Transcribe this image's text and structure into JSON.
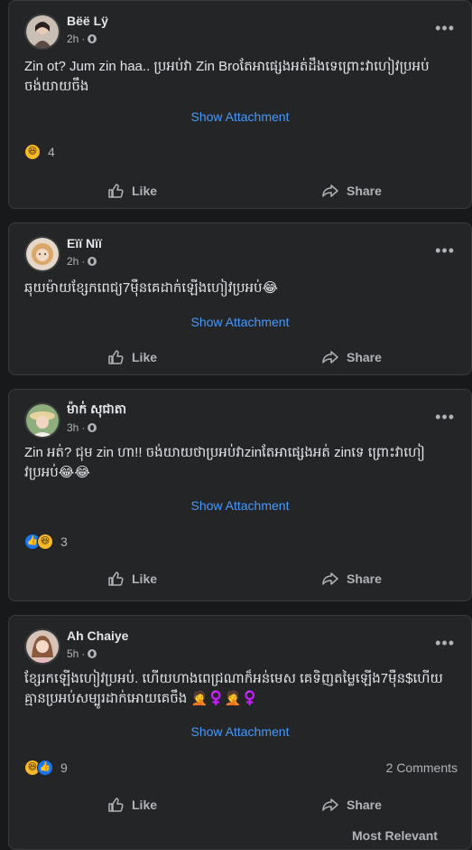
{
  "posts": [
    {
      "name": "Bëë Lÿ",
      "time": "2h",
      "text": "Zin ot? Jum zin haa.. ប្រអប់វា Zin Broតែអាផ្សេងអត់ដឹងទេព្រោះវាហៀវប្រអប់ ចង់យាយចឹង",
      "attachment": "Show Attachment",
      "reaction_count": "4",
      "reactions": [
        "haha"
      ],
      "like": "Like",
      "share": "Share"
    },
    {
      "name": "Eïï Nïï",
      "time": "2h",
      "text": "ឆុយម៉ាយខ្សែកពេជ្យ7ម៉ឺនគេដាក់ឡើងហៀវប្រអប់😂",
      "attachment": "Show Attachment",
      "like": "Like",
      "share": "Share"
    },
    {
      "name": "ម៉ាក់ សុជាតា",
      "time": "3h",
      "text": "Zin អត់? ជុម zin ហា!! ចង់យាយថាប្រអប់វាzinតែអាផ្សេងអត់ zinទេ ព្រោះវាហៀវប្រអប់😂😂",
      "attachment": "Show Attachment",
      "reaction_count": "3",
      "reactions": [
        "like",
        "haha"
      ],
      "like": "Like",
      "share": "Share"
    },
    {
      "name": "Ah Chaiye",
      "time": "5h",
      "text": "ខ្សែរកឡើងហៀវប្រអប់. ហើយហាងពេជ្រណាក៏អន់មេស គេទិញតម្លៃឡើង7ម៉ឺន$ហើយ គ្មានប្រអប់សម្បូរដាក់អោយគេចឹង 🤦‍♀️🤦‍♀️",
      "attachment": "Show Attachment",
      "reaction_count": "9",
      "reactions": [
        "haha",
        "like"
      ],
      "comments": "2 Comments",
      "like": "Like",
      "share": "Share"
    }
  ],
  "footer": {
    "partial_text": "Most Relevant"
  },
  "colors": {
    "background": "#18191a",
    "card": "#242526",
    "link": "#4599ff",
    "muted": "#b0b3b8"
  }
}
